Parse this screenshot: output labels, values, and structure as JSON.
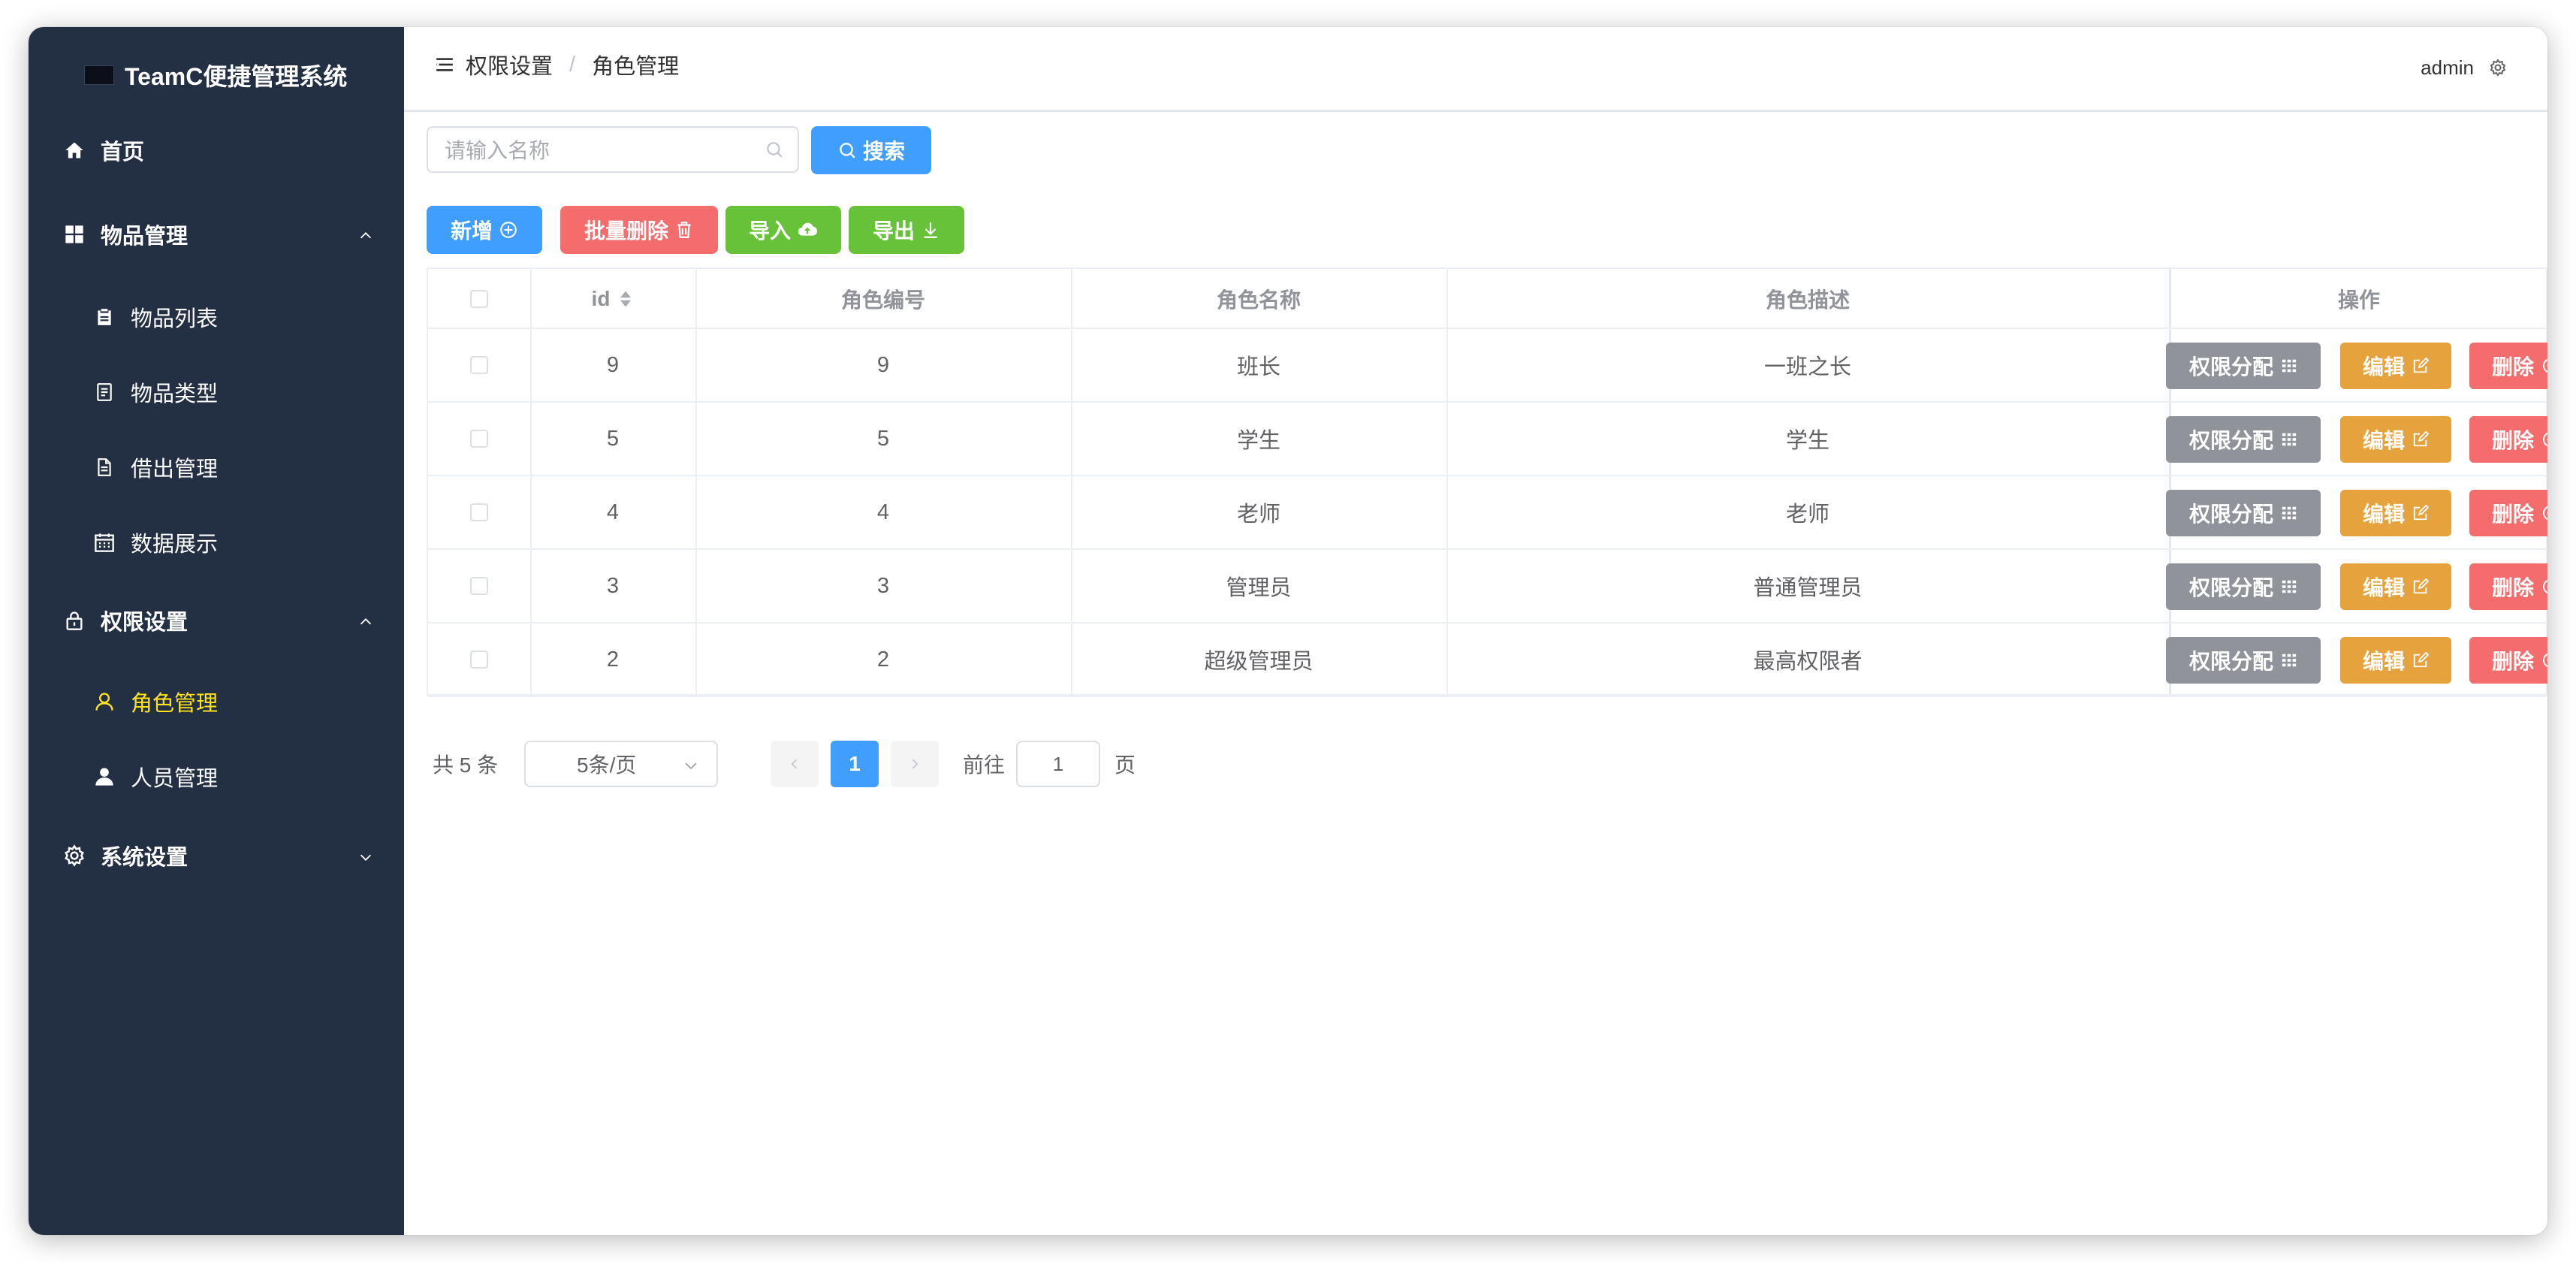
{
  "app": {
    "title": "TeamC便捷管理系统",
    "logo_text": "TeamC"
  },
  "sidebar": {
    "items": [
      {
        "label": "首页",
        "icon": "home-icon"
      },
      {
        "label": "物品管理",
        "icon": "grid-icon",
        "expanded": true,
        "children": [
          {
            "label": "物品列表",
            "icon": "clipboard-icon"
          },
          {
            "label": "物品类型",
            "icon": "document-icon"
          },
          {
            "label": "借出管理",
            "icon": "file-icon"
          },
          {
            "label": "数据展示",
            "icon": "calendar-icon"
          }
        ]
      },
      {
        "label": "权限设置",
        "icon": "lock-icon",
        "expanded": true,
        "children": [
          {
            "label": "角色管理",
            "icon": "user-outline-icon",
            "active": true
          },
          {
            "label": "人员管理",
            "icon": "user-icon"
          }
        ]
      },
      {
        "label": "系统设置",
        "icon": "gear-icon",
        "expanded": false
      }
    ],
    "active_color": "#ffe21e",
    "bg_color": "#233043"
  },
  "header": {
    "breadcrumb": [
      "权限设置",
      "角色管理"
    ],
    "separator": "/",
    "user": "admin"
  },
  "search": {
    "placeholder": "请输入名称",
    "button_label": "搜索"
  },
  "toolbar": {
    "add_label": "新增",
    "batch_delete_label": "批量删除",
    "import_label": "导入",
    "export_label": "导出"
  },
  "table": {
    "columns": [
      "id",
      "角色编号",
      "角色名称",
      "角色描述",
      "操作"
    ],
    "rows": [
      {
        "id": "9",
        "code": "9",
        "name": "班长",
        "desc": "一班之长"
      },
      {
        "id": "5",
        "code": "5",
        "name": "学生",
        "desc": "学生"
      },
      {
        "id": "4",
        "code": "4",
        "name": "老师",
        "desc": "老师"
      },
      {
        "id": "3",
        "code": "3",
        "name": "管理员",
        "desc": "普通管理员"
      },
      {
        "id": "2",
        "code": "2",
        "name": "超级管理员",
        "desc": "最高权限者"
      }
    ],
    "actions": {
      "assign": "权限分配",
      "edit": "编辑",
      "delete": "删除"
    }
  },
  "pagination": {
    "total_text": "共 5 条",
    "page_size": "5条/页",
    "current_page": "1",
    "goto_label": "前往",
    "goto_value": "1",
    "page_unit": "页"
  },
  "colors": {
    "primary": "#409eff",
    "danger": "#f56c6c",
    "success": "#67c23a",
    "info": "#909399",
    "warning": "#e6a23c"
  }
}
